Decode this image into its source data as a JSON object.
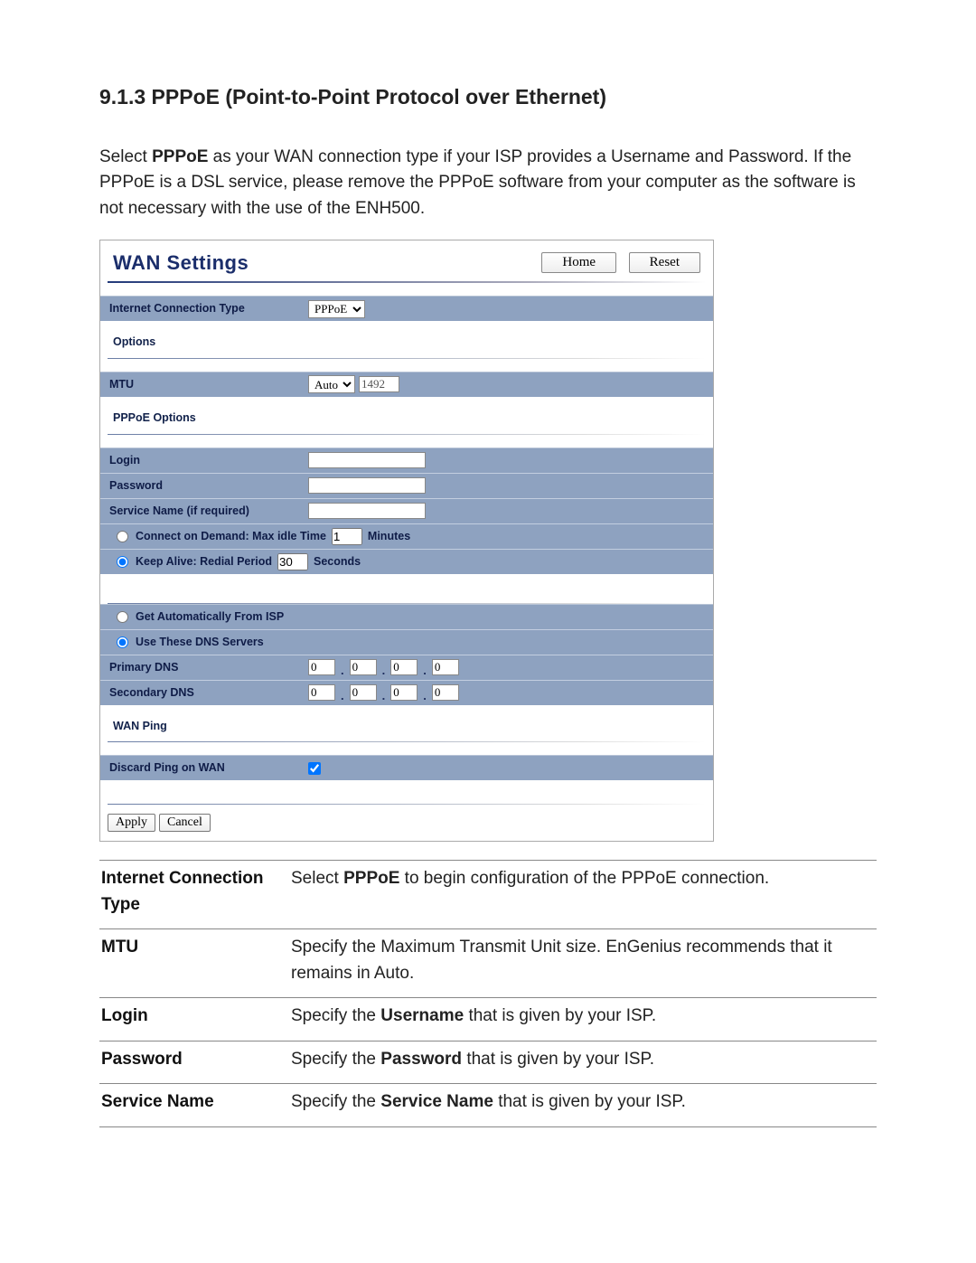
{
  "page": {
    "section_number": "9.1.3",
    "section_title": "PPPoE (Point-to-Point Protocol over Ethernet)",
    "intro_pre": "Select ",
    "intro_bold": "PPPoE",
    "intro_post": " as your WAN connection type if your ISP provides a Username and Password. If the PPPoE is a DSL service, please remove the PPPoE software from your computer as the software is not necessary with the use of the ENH500."
  },
  "wan": {
    "title": "WAN Settings",
    "home_btn": "Home",
    "reset_btn": "Reset",
    "ict_label": "Internet Connection Type",
    "ict_value": "PPPoE",
    "options_heading": "Options",
    "mtu_label": "MTU",
    "mtu_mode": "Auto",
    "mtu_value": "1492",
    "pppoe_heading": "PPPoE Options",
    "login_label": "Login",
    "login_value": "",
    "password_label": "Password",
    "password_value": "",
    "servicename_label": "Service Name (if required)",
    "servicename_value": "",
    "conn_demand_label": "Connect on Demand: Max idle Time",
    "conn_demand_value": "1",
    "conn_demand_suffix": "Minutes",
    "keep_alive_label": "Keep Alive: Redial Period",
    "keep_alive_value": "30",
    "keep_alive_suffix": "Seconds",
    "dns_auto_label": "Get Automatically From ISP",
    "dns_manual_label": "Use These DNS Servers",
    "primary_dns_label": "Primary DNS",
    "secondary_dns_label": "Secondary DNS",
    "dns_octet": "0",
    "wan_ping_heading": "WAN Ping",
    "discard_ping_label": "Discard Ping on WAN",
    "apply_btn": "Apply",
    "cancel_btn": "Cancel"
  },
  "desc": {
    "r1_label": "Internet Connection Type",
    "r1_pre": "Select ",
    "r1_bold": "PPPoE",
    "r1_post": " to begin configuration of the PPPoE connection.",
    "r2_label": "MTU",
    "r2_text": "Specify the Maximum Transmit Unit size. EnGenius recommends that it remains in Auto.",
    "r3_label": "Login",
    "r3_pre": "Specify the ",
    "r3_bold": "Username",
    "r3_post": " that is given by your ISP.",
    "r4_label": "Password",
    "r4_pre": "Specify the ",
    "r4_bold": "Password",
    "r4_post": " that is given by your ISP.",
    "r5_label": "Service Name",
    "r5_pre": "Specify the ",
    "r5_bold": "Service Name",
    "r5_post": " that is given by your ISP."
  }
}
